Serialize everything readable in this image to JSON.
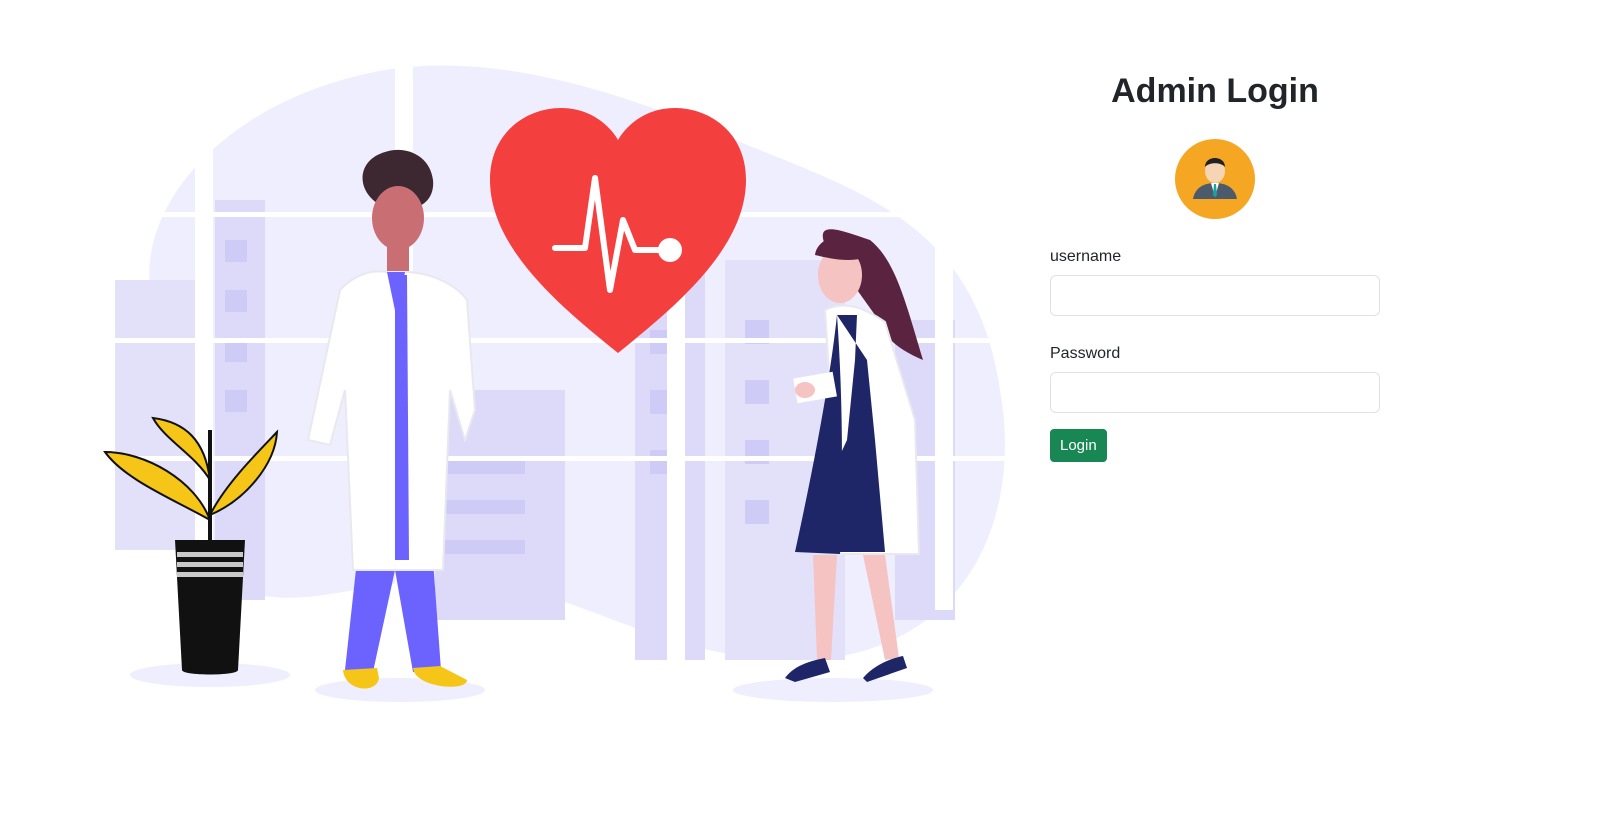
{
  "login": {
    "title": "Admin Login",
    "username_label": "username",
    "username_value": "",
    "password_label": "Password",
    "password_value": "",
    "button_label": "Login"
  },
  "illustration": {
    "icons": [
      "doctor-figure",
      "female-doctor-figure",
      "heart-pulse-icon",
      "plant-pot",
      "city-window-background"
    ]
  },
  "avatar": {
    "icon": "admin-user-icon",
    "color": "#f5a623"
  },
  "colors": {
    "button": "#198754",
    "heart": "#f43f3f",
    "accent": "#6c63ff"
  }
}
